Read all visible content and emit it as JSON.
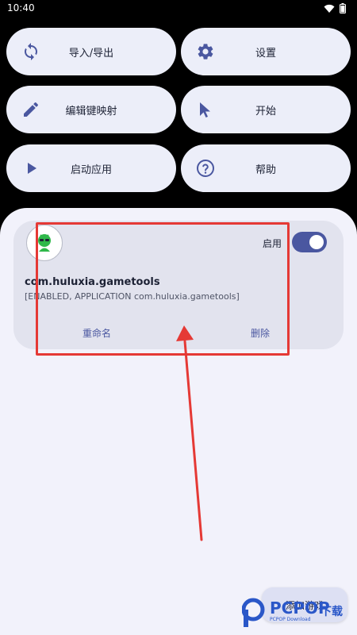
{
  "status_bar": {
    "time": "10:40"
  },
  "buttons": {
    "import_export": "导入/导出",
    "settings": "设置",
    "edit_keymap": "编辑键映射",
    "start": "开始",
    "launch_app": "启动应用",
    "help": "帮助"
  },
  "card": {
    "enable_label": "启用",
    "enabled": true,
    "app_name": "com.huluxia.gametools",
    "app_status": "[ENABLED, APPLICATION com.huluxia.gametools]",
    "rename": "重命名",
    "delete": "删除"
  },
  "fab": {
    "label": "添加游戏"
  },
  "watermark": {
    "brand": "PCPOP",
    "suffix": "下载",
    "sub": "PCPOP Download"
  },
  "colors": {
    "accent": "#4a57a0",
    "annotation": "#e53935"
  }
}
